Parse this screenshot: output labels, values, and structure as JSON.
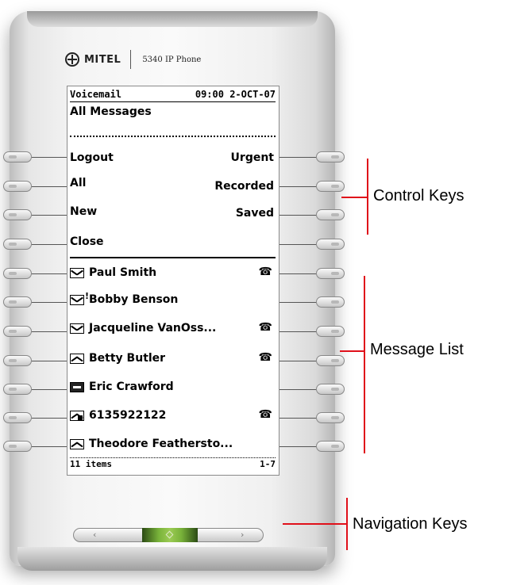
{
  "brand": {
    "logo": "MITEL",
    "model": "5340 IP Phone"
  },
  "screen": {
    "app": "Voicemail",
    "time": "09:00",
    "date": "2-OCT-07",
    "title": "All Messages",
    "footer_count": "11 items",
    "footer_range": "1-7"
  },
  "control_keys": {
    "left": [
      "Logout",
      "All",
      "New",
      "Close"
    ],
    "right": [
      "Urgent",
      "Recorded",
      "Saved",
      ""
    ]
  },
  "messages": [
    {
      "name": "Paul Smith",
      "icon": "envelope-closed",
      "forwarded": true
    },
    {
      "name": "Bobby Benson",
      "icon": "envelope-urgent",
      "forwarded": false
    },
    {
      "name": "Jacqueline VanOss...",
      "icon": "envelope-closed",
      "forwarded": true
    },
    {
      "name": "Betty Butler",
      "icon": "envelope-open",
      "forwarded": true
    },
    {
      "name": "Eric Crawford",
      "icon": "recorded-tape",
      "forwarded": false
    },
    {
      "name": "6135922122",
      "icon": "envelope-locked",
      "forwarded": true
    },
    {
      "name": "Theodore Feathersto...",
      "icon": "envelope-open",
      "forwarded": false
    }
  ],
  "annotations": {
    "control": "Control Keys",
    "messages": "Message List",
    "navigation": "Navigation Keys"
  },
  "colors": {
    "annotation_line": "#e0101a",
    "nav_center": "#79b33a"
  }
}
